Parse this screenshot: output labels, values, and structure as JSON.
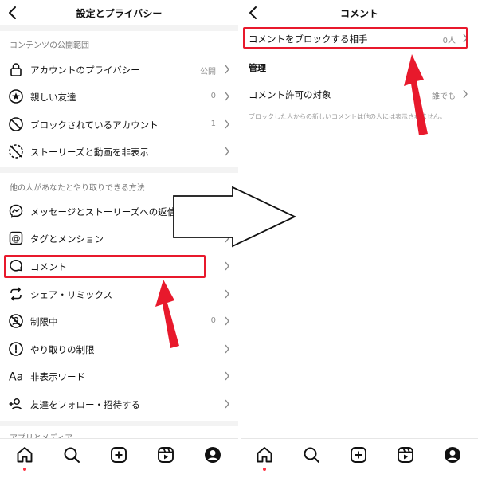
{
  "left": {
    "header": {
      "title": "設定とプライバシー"
    },
    "section1": {
      "title": "コンテンツの公開範囲",
      "items": [
        {
          "label": "アカウントのプライバシー",
          "value": "公開",
          "icon": "lock-icon"
        },
        {
          "label": "親しい友達",
          "value": "0",
          "icon": "star-circle-icon"
        },
        {
          "label": "ブロックされているアカウント",
          "value": "1",
          "icon": "block-icon"
        },
        {
          "label": "ストーリーズと動画を非表示",
          "value": "",
          "icon": "hide-story-icon"
        }
      ]
    },
    "section2": {
      "title": "他の人があなたとやり取りできる方法",
      "items": [
        {
          "label": "メッセージとストーリーズへの返信",
          "value": "",
          "icon": "messenger-icon"
        },
        {
          "label": "タグとメンション",
          "value": "",
          "icon": "at-icon"
        },
        {
          "label": "コメント",
          "value": "",
          "icon": "comment-icon"
        },
        {
          "label": "シェア・リミックス",
          "value": "",
          "icon": "remix-icon"
        },
        {
          "label": "制限中",
          "value": "0",
          "icon": "restrict-icon"
        },
        {
          "label": "やり取りの制限",
          "value": "",
          "icon": "limit-icon"
        },
        {
          "label": "非表示ワード",
          "value": "",
          "icon": "hidden-words-icon"
        },
        {
          "label": "友達をフォロー・招待する",
          "value": "",
          "icon": "add-person-icon"
        }
      ]
    },
    "section3": {
      "title": "アプリとメディア"
    }
  },
  "right": {
    "header": {
      "title": "コメント"
    },
    "blocked": {
      "label": "コメントをブロックする相手",
      "value": "0人"
    },
    "manage_title": "管理",
    "allow": {
      "label": "コメント許可の対象",
      "value": "誰でも"
    },
    "note": "ブロックした人からの新しいコメントは他の人には表示されません。"
  },
  "tabbar": [
    "home-icon",
    "search-icon",
    "create-icon",
    "reels-icon",
    "profile-icon"
  ],
  "colors": {
    "highlight": "#e8192c",
    "arrow": "#e8192c",
    "notification_dot": "#ff3040"
  }
}
